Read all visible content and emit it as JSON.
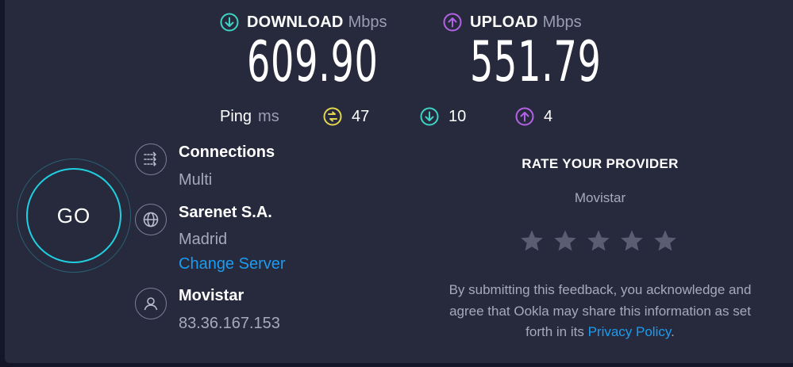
{
  "download": {
    "label": "DOWNLOAD",
    "unit": "Mbps",
    "value": "609.90",
    "icon": "arrow-down-circle-icon",
    "color": "#3ed4c4"
  },
  "upload": {
    "label": "UPLOAD",
    "unit": "Mbps",
    "value": "551.79",
    "icon": "arrow-up-circle-icon",
    "color": "#b362e6"
  },
  "ping": {
    "label": "Ping",
    "unit": "ms",
    "idle": {
      "value": "47",
      "icon": "ping-idle-icon",
      "color": "#e4d64f"
    },
    "download": {
      "value": "10",
      "icon": "arrow-down-circle-icon",
      "color": "#3ed4c4"
    },
    "upload": {
      "value": "4",
      "icon": "arrow-up-circle-icon",
      "color": "#b362e6"
    }
  },
  "go_button": {
    "label": "GO",
    "color": "#1fd0e0"
  },
  "connections": {
    "title": "Connections",
    "value": "Multi",
    "icon": "connections-icon"
  },
  "server": {
    "title": "Sarenet S.A.",
    "location": "Madrid",
    "change_label": "Change Server",
    "icon": "globe-icon"
  },
  "isp": {
    "title": "Movistar",
    "ip": "83.36.167.153",
    "icon": "user-icon"
  },
  "rating": {
    "title": "RATE YOUR PROVIDER",
    "provider": "Movistar",
    "stars_total": 5,
    "stars_selected": 0,
    "disclaimer_line1": "By submitting this feedback, you acknowledge and",
    "disclaimer_line2": "agree that Ookla may share this information as set",
    "disclaimer_line3_prefix": "forth in its ",
    "privacy_link": "Privacy Policy",
    "disclaimer_suffix": "."
  },
  "colors": {
    "background": "#272a3d",
    "link": "#1a9cf0",
    "muted": "#a7a9ba",
    "star": "#5b5d72"
  }
}
